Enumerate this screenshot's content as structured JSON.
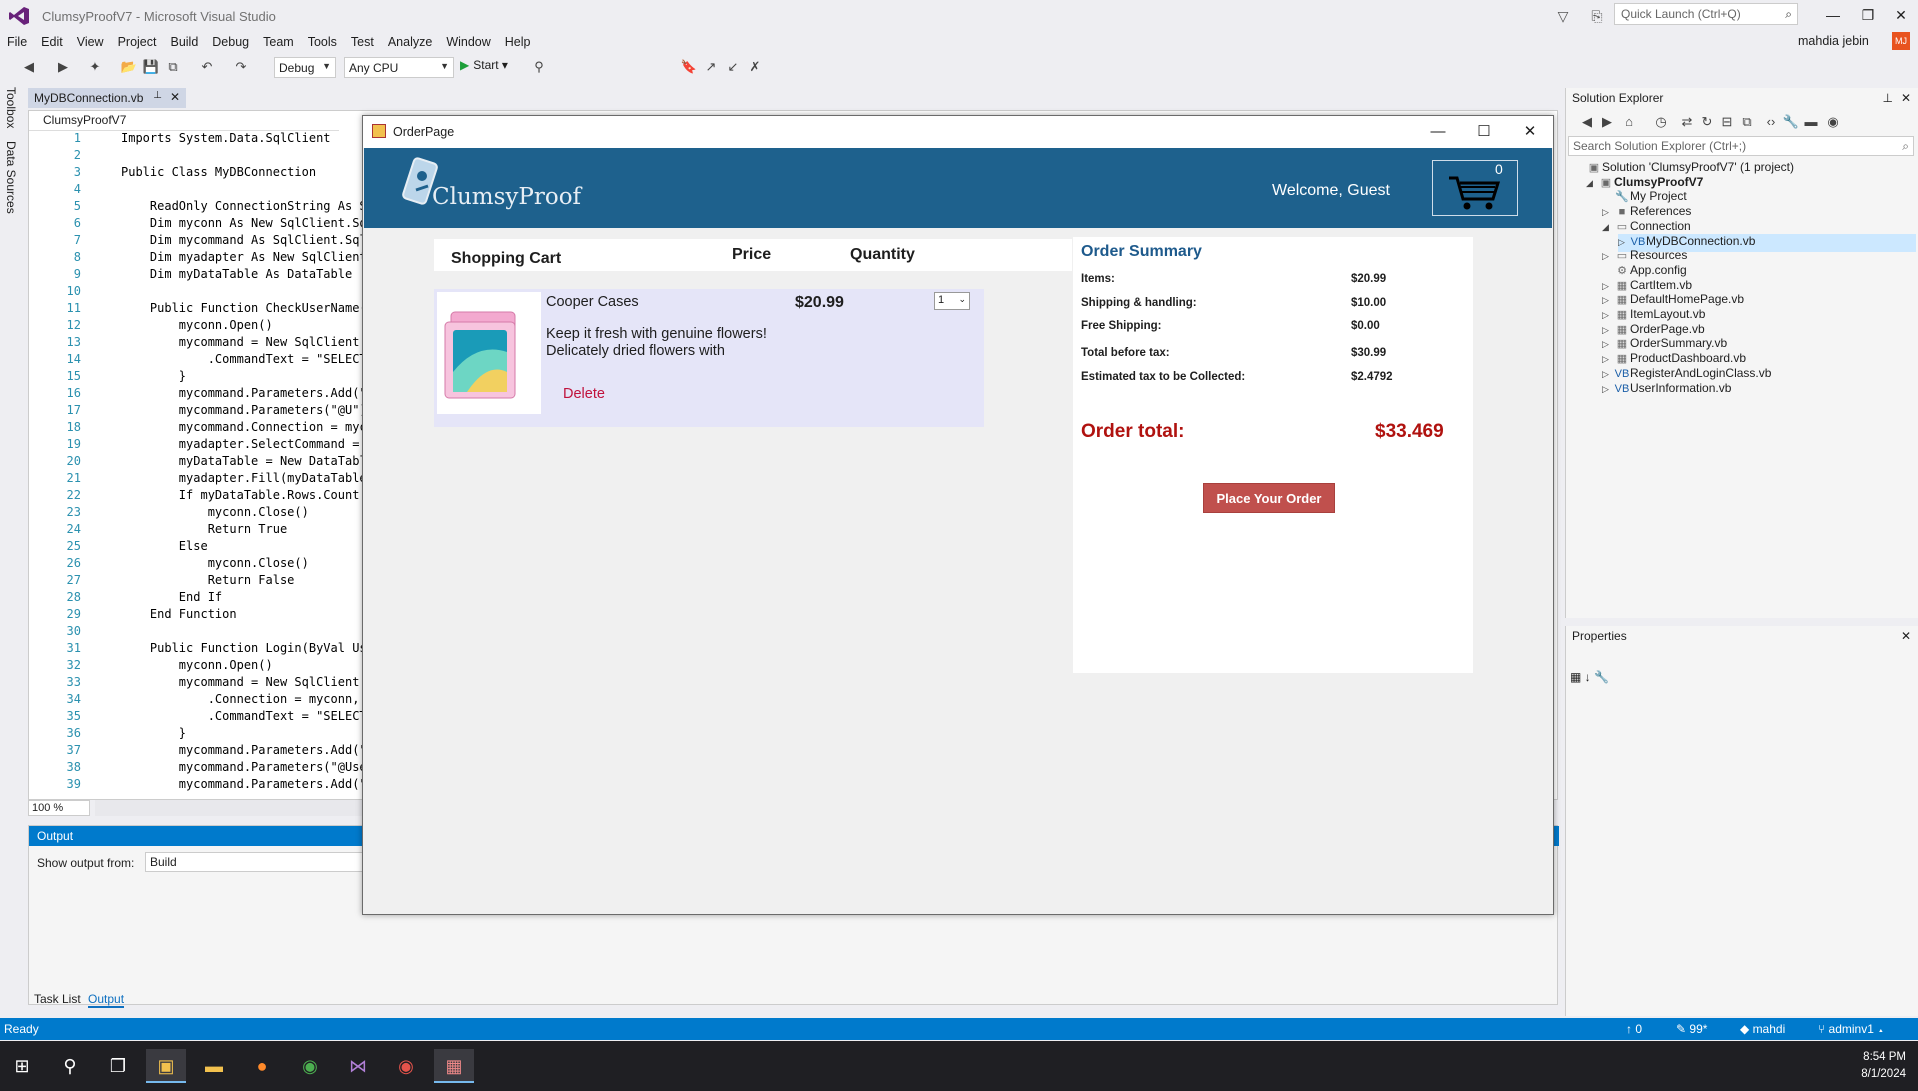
{
  "app": {
    "title": "ClumsyProofV7 - Microsoft Visual Studio",
    "quick_launch_placeholder": "Quick Launch (Ctrl+Q)",
    "user": "mahdia jebin",
    "avatar_initials": "MJ"
  },
  "menu": [
    "File",
    "Edit",
    "View",
    "Project",
    "Build",
    "Debug",
    "Team",
    "Tools",
    "Test",
    "Analyze",
    "Window",
    "Help"
  ],
  "toolbar": {
    "config": "Debug",
    "platform": "Any CPU",
    "start_label": "Start"
  },
  "left_rail": {
    "toolbox": "Toolbox",
    "data_sources": "Data Sources"
  },
  "editor": {
    "tab_label": "MyDBConnection.vb",
    "project_combo": "ClumsyProofV7",
    "zoom": "100 %",
    "lines": [
      {
        "n": "1",
        "t": "Imports System.Data.SqlClient"
      },
      {
        "n": "2",
        "t": ""
      },
      {
        "n": "3",
        "t": "Public Class MyDBConnection"
      },
      {
        "n": "4",
        "t": ""
      },
      {
        "n": "5",
        "t": "    ReadOnly ConnectionString As St"
      },
      {
        "n": "6",
        "t": "    Dim myconn As New SqlClient.Sq"
      },
      {
        "n": "7",
        "t": "    Dim mycommand As SqlClient.Sql"
      },
      {
        "n": "8",
        "t": "    Dim myadapter As New SqlClient."
      },
      {
        "n": "9",
        "t": "    Dim myDataTable As DataTable"
      },
      {
        "n": "10",
        "t": ""
      },
      {
        "n": "11",
        "t": "    Public Function CheckUserName(B"
      },
      {
        "n": "12",
        "t": "        myconn.Open()"
      },
      {
        "n": "13",
        "t": "        mycommand = New SqlClient.S"
      },
      {
        "n": "14",
        "t": "            .CommandText = \"SELECT"
      },
      {
        "n": "15",
        "t": "        }"
      },
      {
        "n": "16",
        "t": "        mycommand.Parameters.Add(\""
      },
      {
        "n": "17",
        "t": "        mycommand.Parameters(\"@U\")"
      },
      {
        "n": "18",
        "t": "        mycommand.Connection = myco"
      },
      {
        "n": "19",
        "t": "        myadapter.SelectCommand = m"
      },
      {
        "n": "20",
        "t": "        myDataTable = New DataTable"
      },
      {
        "n": "21",
        "t": "        myadapter.Fill(myDataTable)"
      },
      {
        "n": "22",
        "t": "        If myDataTable.Rows.Count"
      },
      {
        "n": "23",
        "t": "            myconn.Close()"
      },
      {
        "n": "24",
        "t": "            Return True"
      },
      {
        "n": "25",
        "t": "        Else"
      },
      {
        "n": "26",
        "t": "            myconn.Close()"
      },
      {
        "n": "27",
        "t": "            Return False"
      },
      {
        "n": "28",
        "t": "        End If"
      },
      {
        "n": "29",
        "t": "    End Function"
      },
      {
        "n": "30",
        "t": ""
      },
      {
        "n": "31",
        "t": "    Public Function Login(ByVal Use"
      },
      {
        "n": "32",
        "t": "        myconn.Open()"
      },
      {
        "n": "33",
        "t": "        mycommand = New SqlClient.S"
      },
      {
        "n": "34",
        "t": "            .Connection = myconn,"
      },
      {
        "n": "35",
        "t": "            .CommandText = \"SELECT"
      },
      {
        "n": "36",
        "t": "        }"
      },
      {
        "n": "37",
        "t": "        mycommand.Parameters.Add(\""
      },
      {
        "n": "38",
        "t": "        mycommand.Parameters(\"@User"
      },
      {
        "n": "39",
        "t": "        mycommand.Parameters.Add(\""
      }
    ]
  },
  "output": {
    "title": "Output",
    "show_from_label": "Show output from:",
    "source": "Build"
  },
  "bottom_tabs": {
    "task_list": "Task List",
    "output": "Output"
  },
  "status": {
    "text": "Ready",
    "up": "0",
    "edits": "99*",
    "repo": "mahdi",
    "branch": "adminv1"
  },
  "clock": {
    "time": "8:54 PM",
    "date": "8/1/2024"
  },
  "solution_explorer": {
    "title": "Solution Explorer",
    "search_placeholder": "Search Solution Explorer (Ctrl+;)",
    "items": [
      {
        "label": "Solution 'ClumsyProofV7' (1 project)"
      },
      {
        "label": "ClumsyProofV7"
      },
      {
        "label": "My Project"
      },
      {
        "label": "References"
      },
      {
        "label": "Connection"
      },
      {
        "label": "MyDBConnection.vb"
      },
      {
        "label": "Resources"
      },
      {
        "label": "App.config"
      },
      {
        "label": "CartItem.vb"
      },
      {
        "label": "DefaultHomePage.vb"
      },
      {
        "label": "ItemLayout.vb"
      },
      {
        "label": "OrderPage.vb"
      },
      {
        "label": "OrderSummary.vb"
      },
      {
        "label": "ProductDashboard.vb"
      },
      {
        "label": "RegisterAndLoginClass.vb"
      },
      {
        "label": "UserInformation.vb"
      }
    ]
  },
  "properties": {
    "title": "Properties"
  },
  "order_page": {
    "window_title": "OrderPage",
    "logo_text": "ClumsyProof",
    "welcome": "Welcome, Guest",
    "cart_count": "0",
    "cart_header": {
      "title": "Shopping Cart",
      "price": "Price",
      "quantity": "Quantity"
    },
    "item": {
      "name": "Cooper Cases",
      "price": "$20.99",
      "quantity": "1",
      "description_line1": "Keep it fresh with genuine flowers!",
      "description_line2": "Delicately dried flowers with",
      "delete_label": "Delete"
    },
    "summary": {
      "title": "Order Summary",
      "rows": [
        {
          "label": "Items:",
          "value": "$20.99"
        },
        {
          "label": "Shipping & handling:",
          "value": "$10.00"
        },
        {
          "label": "Free Shipping:",
          "value": "$0.00"
        },
        {
          "label": "Total before tax:",
          "value": "$30.99"
        },
        {
          "label": "Estimated tax to be Collected:",
          "value": "$2.4792"
        }
      ],
      "total_label": "Order total:",
      "total_value": "$33.469",
      "place_order_label": "Place Your Order"
    }
  },
  "colors": {
    "vs_blue": "#007acc",
    "header_blue": "#1e618d",
    "order_red": "#b0120f",
    "button_red": "#c0504d",
    "cart_row": "#e5e5f8"
  }
}
